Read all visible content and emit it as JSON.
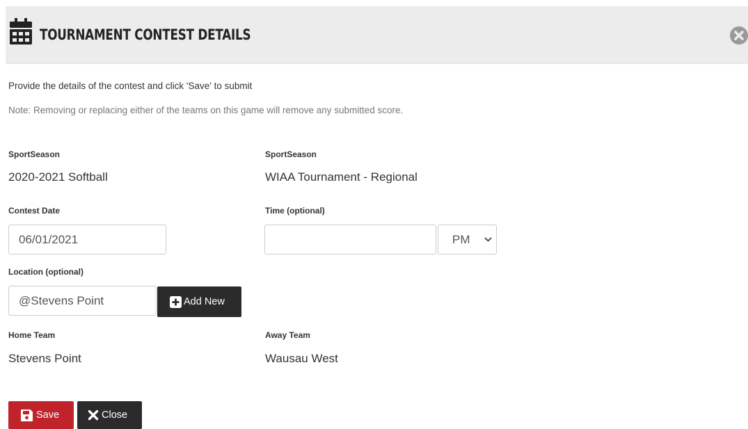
{
  "modal": {
    "title": "TOURNAMENT CONTEST DETAILS",
    "header_icon": "calendar-icon",
    "close_icon": "close-circle-icon"
  },
  "intro_text": "Provide the details of the contest and click 'Save' to submit",
  "note_text": "Note: Removing or replacing either of the teams on this game will remove any submitted score.",
  "fields": {
    "sport_season_1": {
      "label": "SportSeason",
      "value": "2020-2021 Softball"
    },
    "sport_season_2": {
      "label": "SportSeason",
      "value": "WIAA Tournament - Regional"
    },
    "contest_date": {
      "label": "Contest Date",
      "value": "06/01/2021"
    },
    "time": {
      "label": "Time (optional)",
      "value": "",
      "ampm": "PM"
    },
    "location": {
      "label": "Location (optional)",
      "value": "@Stevens Point",
      "add_new_label": "Add New"
    },
    "home_team": {
      "label": "Home Team",
      "value": "Stevens Point"
    },
    "away_team": {
      "label": "Away Team",
      "value": "Wausau West"
    }
  },
  "buttons": {
    "save": "Save",
    "close": "Close"
  },
  "colors": {
    "header_bg": "#ececec",
    "save_button": "#c0242a",
    "dark_button": "#2b2b2b",
    "note_text": "#777777"
  }
}
